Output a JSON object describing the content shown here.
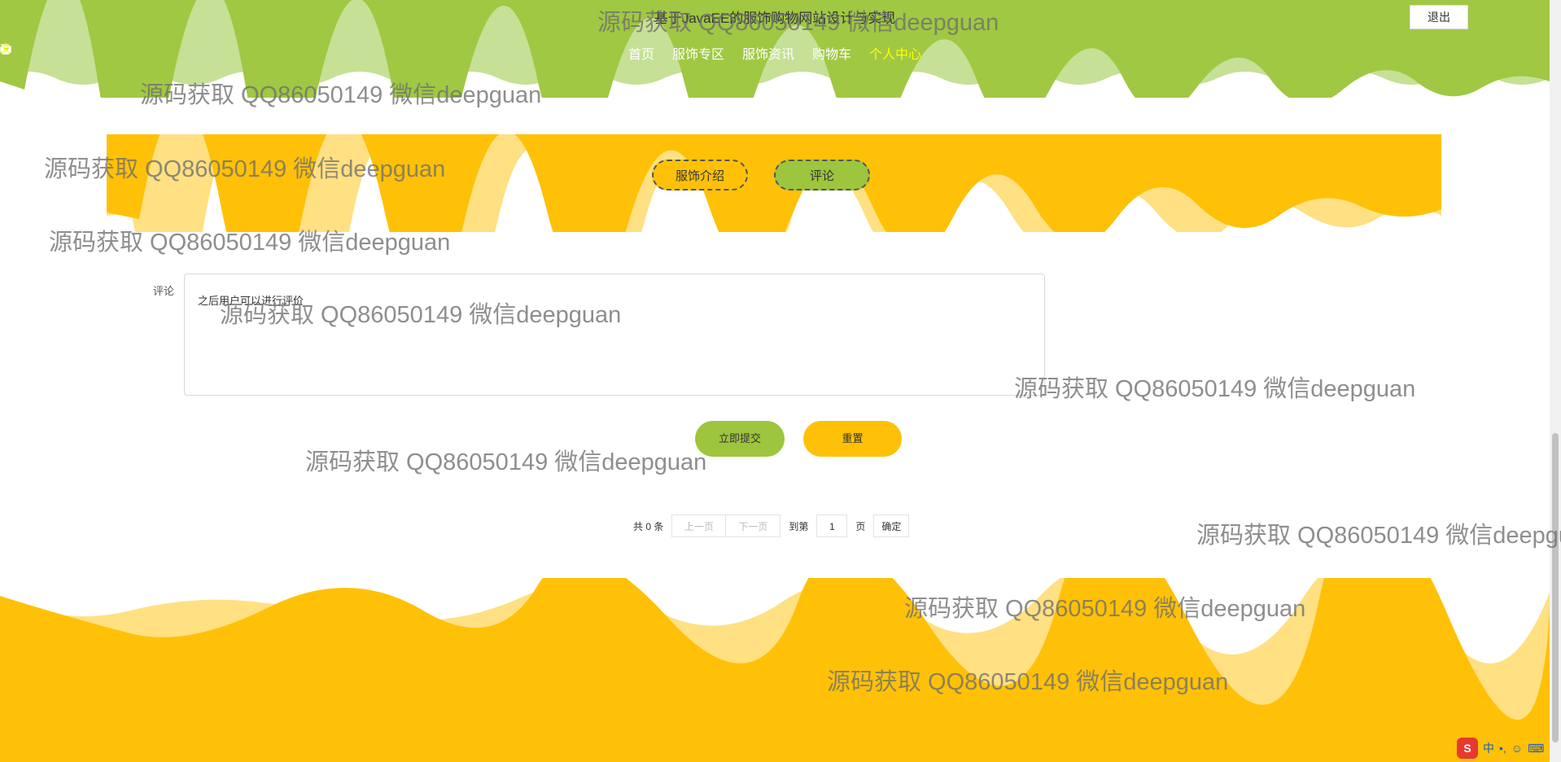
{
  "header": {
    "title": "基于JavaEE的服饰购物网站设计与实现",
    "logout_label": "退出",
    "nav": [
      {
        "label": "首页",
        "icon": "home-icon"
      },
      {
        "label": "服饰专区",
        "icon": "circle-icon"
      },
      {
        "label": "服饰资讯",
        "icon": "printer-icon"
      },
      {
        "label": "购物车",
        "icon": "cart-icon"
      },
      {
        "label": "个人中心",
        "icon": "user-icon",
        "active": true
      }
    ]
  },
  "tabs": [
    {
      "label": "服饰介绍"
    },
    {
      "label": "评论",
      "selected": true
    }
  ],
  "comment_form": {
    "label": "评论",
    "value": "之后用户可以进行评价",
    "submit_label": "立即提交",
    "reset_label": "重置"
  },
  "pagination": {
    "total_text": "共 0 条",
    "prev_label": "上一页",
    "next_label": "下一页",
    "goto_label": "到第",
    "page_value": "1",
    "page_unit": "页",
    "confirm_label": "确定"
  },
  "watermark": {
    "text": "源码获取 QQ86050149 微信deepguan"
  },
  "ime": {
    "mode": "中",
    "logo": "S"
  },
  "colors": {
    "green": "#9dc53d",
    "yellow": "#ffc107",
    "light_yellow": "#ffe082"
  }
}
